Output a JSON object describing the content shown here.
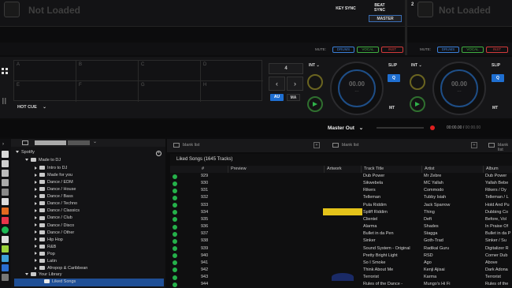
{
  "deck_left": {
    "number": "",
    "title": "Not Loaded",
    "key_sync": "KEY SYNC",
    "beat_sync": "BEAT\nSYNC",
    "master": "MASTER",
    "mute": "MUTE:",
    "drums": "DRUMS",
    "vocal": "VOCAL",
    "inst": "INST"
  },
  "deck_right": {
    "number": "2",
    "title": "Not Loaded",
    "mute": "MUTE:",
    "drums": "DRUMS",
    "vocal": "VOCAL",
    "inst": "INST"
  },
  "hotcue": {
    "label": "HOT CUE",
    "pads": [
      "A",
      "B",
      "C",
      "D",
      "E",
      "F",
      "G",
      "H"
    ]
  },
  "left_controls": {
    "beatjump": "4",
    "prev": "‹",
    "next": "›",
    "au": "AU",
    "ma": "MA",
    "int": "INT",
    "slip": "SLIP",
    "q": "Q",
    "mt": "MT",
    "time": "00.00",
    "bpm": "---"
  },
  "right_controls": {
    "int": "INT",
    "slip": "SLIP",
    "q": "Q",
    "mt": "MT",
    "time": "00.00",
    "bpm": "---"
  },
  "master_out": {
    "label": "Master Out",
    "time_a": "00:00.00",
    "time_b": "00:00.00"
  },
  "panels": {
    "blank1": "blank list",
    "blank2": "blank list",
    "blank3": "blank list"
  },
  "tree": {
    "spotify": "Spotify",
    "made_to_dj": "Made to DJ",
    "items": [
      "Intro to DJ",
      "Made for you",
      "Dance / EDM",
      "Dance / House",
      "Dance / Bass",
      "Dance / Techno",
      "Dance / Classics",
      "Dance / Club",
      "Dance / Disco",
      "Dance / Other",
      "Hip Hop",
      "R&B",
      "Pop",
      "Latin",
      "Afropop & Caribbean"
    ],
    "your_library": "Your Library",
    "liked_songs": "Liked Songs"
  },
  "table": {
    "title": "Liked Songs (1645 Tracks)",
    "columns": {
      "num": "#",
      "preview": "Preview",
      "artwork": "Artwork",
      "track": "Track Title",
      "artist": "Artist",
      "album": "Album"
    },
    "rows": [
      {
        "num": "929",
        "track": "Dub Power",
        "artist": "Mr Zebre",
        "album": "Dub Power"
      },
      {
        "num": "930",
        "track": "Sikwebela",
        "artist": "MC Yallah",
        "album": "Yallah Bebe"
      },
      {
        "num": "931",
        "track": "Rikers",
        "artist": "Commodo",
        "album": "Rikers / Dy"
      },
      {
        "num": "932",
        "track": "Telleman",
        "artist": "Tubby Isiah",
        "album": "Telleman / L"
      },
      {
        "num": "933",
        "track": "Pula Riddim",
        "artist": "Jack Sparrow",
        "album": "Hold And Pu"
      },
      {
        "num": "934",
        "track": "Spliff Riddim",
        "artist": "Thing",
        "album": "Dubbing Co"
      },
      {
        "num": "935",
        "track": "Clientel",
        "artist": "Deft",
        "album": "Before, Vol"
      },
      {
        "num": "936",
        "track": "Alarma",
        "artist": "Shades",
        "album": "In Praise Of"
      },
      {
        "num": "937",
        "track": "Bullet in da Pen",
        "artist": "Stagga",
        "album": "Bullet in da P"
      },
      {
        "num": "938",
        "track": "Sinker",
        "artist": "Goth-Trad",
        "album": "Sinker / Su"
      },
      {
        "num": "939",
        "track": "Sound System - Original",
        "artist": "Radikal Guru",
        "album": "Digitalizer R"
      },
      {
        "num": "940",
        "track": "Pretty Bright Light",
        "artist": "RSD",
        "album": "Corner Dub"
      },
      {
        "num": "941",
        "track": "So I Smoke",
        "artist": "Ago",
        "album": "Above"
      },
      {
        "num": "942",
        "track": "Think About Me",
        "artist": "Kenji Ajisai",
        "album": "Dark Adona"
      },
      {
        "num": "943",
        "track": "Terrorist",
        "artist": "Karma",
        "album": "Terrorist"
      },
      {
        "num": "944",
        "track": "Rules of the Dance -",
        "artist": "Mungo's Hi Fi",
        "album": "Rules of the"
      }
    ]
  },
  "colors": {
    "accent": "#1f6fd1",
    "green": "#25b14a",
    "record": "#e02020",
    "drums": "#3a7fd8",
    "vocal": "#3fae3f",
    "inst": "#d23a3a"
  }
}
